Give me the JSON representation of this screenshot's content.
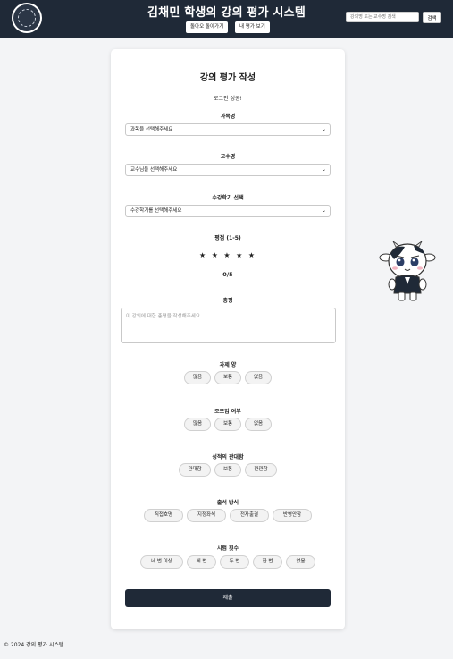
{
  "header": {
    "title": "김채민 학생의 강의 평가 시스템",
    "back_button": "돌아오 돌아가기",
    "my_reviews_button": "내 평가 보기",
    "search_placeholder": "강의명 또는 교수명 검색",
    "search_button": "검색",
    "logo_icon": "university-seal-icon"
  },
  "form": {
    "title": "강의 평가 작성",
    "login_message": "로그인 성공!",
    "course": {
      "label": "과목명",
      "placeholder": "과목을 선택해주세요"
    },
    "professor": {
      "label": "교수명",
      "placeholder": "교수님을 선택해주세요"
    },
    "semester": {
      "label": "수강학기 선택",
      "placeholder": "수강학기를 선택해주세요"
    },
    "rating": {
      "label": "평점 (1-5)",
      "stars": "★ ★ ★ ★ ★",
      "value": "0/5"
    },
    "review": {
      "label": "총평",
      "placeholder": "이 강의에 대한 총평을 작성해주세요."
    },
    "assignment": {
      "label": "과제 양",
      "options": [
        "많음",
        "보통",
        "없음"
      ]
    },
    "team_project": {
      "label": "조모임 여부",
      "options": [
        "많음",
        "보통",
        "없음"
      ]
    },
    "grading": {
      "label": "성적의 관대함",
      "options": [
        "관대함",
        "보통",
        "깐깐함"
      ]
    },
    "attendance": {
      "label": "출석 방식",
      "options": [
        "직접호명",
        "지정좌석",
        "전자출결",
        "반영안함"
      ]
    },
    "exams": {
      "label": "시험 횟수",
      "options": [
        "네 번 이상",
        "세 번",
        "두 번",
        "한 번",
        "없음"
      ]
    },
    "submit_label": "제출"
  },
  "footer": {
    "text": "© 2024 강의 평가 시스템"
  },
  "mascot": {
    "icon": "cow-mascot-icon"
  },
  "colors": {
    "header_bg": "#1f2937",
    "submit_bg": "#1f2937",
    "page_bg": "#f3f4f6"
  }
}
